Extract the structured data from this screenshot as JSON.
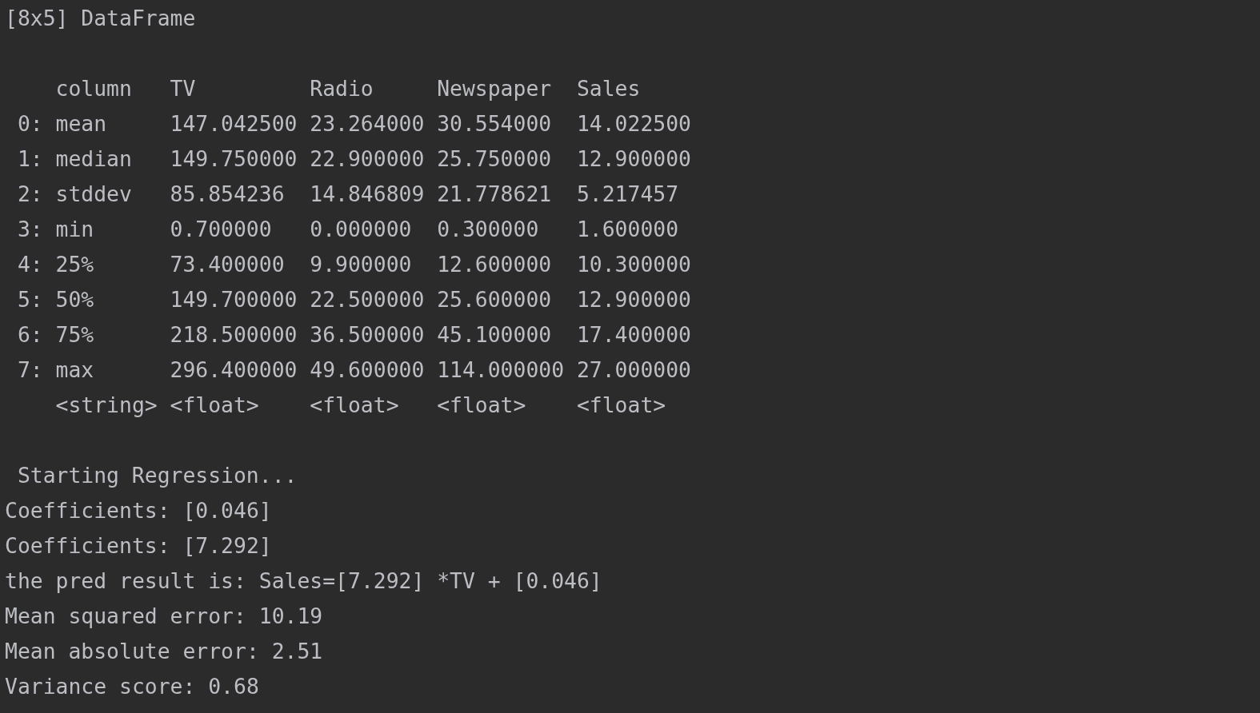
{
  "console": {
    "title": "[8x5] DataFrame",
    "table": {
      "columns": [
        "column",
        "TV",
        "Radio",
        "Newspaper",
        "Sales"
      ],
      "rows": [
        {
          "index": "0:",
          "cells": [
            "mean",
            "147.042500",
            "23.264000",
            "30.554000",
            "14.022500"
          ]
        },
        {
          "index": "1:",
          "cells": [
            "median",
            "149.750000",
            "22.900000",
            "25.750000",
            "12.900000"
          ]
        },
        {
          "index": "2:",
          "cells": [
            "stddev",
            "85.854236",
            "14.846809",
            "21.778621",
            "5.217457"
          ]
        },
        {
          "index": "3:",
          "cells": [
            "min",
            "0.700000",
            "0.000000",
            "0.300000",
            "1.600000"
          ]
        },
        {
          "index": "4:",
          "cells": [
            "25%",
            "73.400000",
            "9.900000",
            "12.600000",
            "10.300000"
          ]
        },
        {
          "index": "5:",
          "cells": [
            "50%",
            "149.700000",
            "22.500000",
            "25.600000",
            "12.900000"
          ]
        },
        {
          "index": "6:",
          "cells": [
            "75%",
            "218.500000",
            "36.500000",
            "45.100000",
            "17.400000"
          ]
        },
        {
          "index": "7:",
          "cells": [
            "max",
            "296.400000",
            "49.600000",
            "114.000000",
            "27.000000"
          ]
        }
      ],
      "types": [
        "<string>",
        "<float>",
        "<float>",
        "<float>",
        "<float>"
      ]
    },
    "regression": {
      "heading": "Starting Regression...",
      "lines": [
        "Coefficients: [0.046]",
        "Coefficients: [7.292]",
        "the pred result is: Sales=[7.292] *TV + [0.046]",
        "Mean squared error: 10.19",
        "Mean absolute error: 2.51",
        "Variance score: 0.68"
      ]
    }
  }
}
